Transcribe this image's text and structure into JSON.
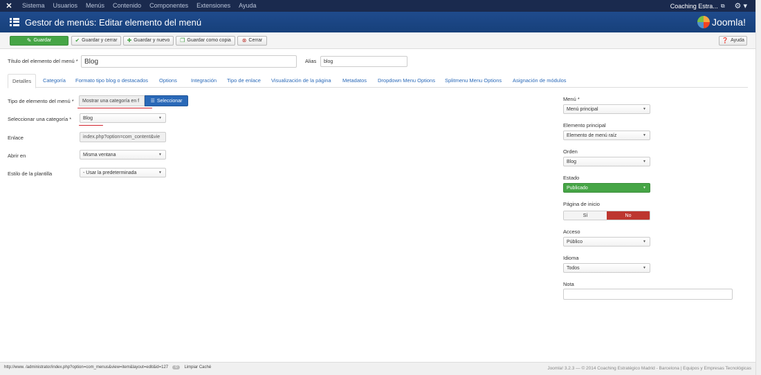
{
  "topnav": {
    "logo_glyph": "✕",
    "menu": [
      "Sistema",
      "Usuarios",
      "Menús",
      "Contenido",
      "Componentes",
      "Extensiones",
      "Ayuda"
    ],
    "site_name": "Coaching Estra...",
    "external_glyph": "⧉",
    "settings_glyph": "⚙ ▾"
  },
  "header": {
    "title": "Gestor de menús: Editar elemento del menú",
    "brand": "Joomla!"
  },
  "toolbar": {
    "save": "Guardar",
    "save_close": "Guardar y cerrar",
    "save_new": "Guardar y nuevo",
    "save_copy": "Guardar como copia",
    "close": "Cerrar",
    "help": "Ayuda",
    "icons": {
      "save": "edit-icon",
      "save_close": "check-icon",
      "save_new": "plus-icon",
      "save_copy": "copy-icon",
      "close": "close-icon",
      "help": "question-icon"
    }
  },
  "form": {
    "title_label": "Título del elemento del menú *",
    "title_value": "Blog",
    "alias_label": "Alias",
    "alias_value": "blog"
  },
  "tabs": [
    "Detalles",
    "Categoría",
    "Formato tipo blog o destacados",
    "Options",
    "Integración",
    "Tipo de enlace",
    "Visualización de la página",
    "Metadatos",
    "Dropdown Menu Options",
    "Splitmenu Menu Options",
    "Asignación de módulos"
  ],
  "details": {
    "type_label": "Tipo de elemento del menú *",
    "type_value": "Mostrar una categoría en f",
    "select_button": "Seleccionar",
    "category_label": "Seleccionar una categoría *",
    "category_value": "Blog",
    "link_label": "Enlace",
    "link_value": "index.php?option=com_content&vie",
    "open_label": "Abrir en",
    "open_value": "Misma ventana",
    "template_label": "Estilo de la plantilla",
    "template_value": "- Usar la predeterminada"
  },
  "sidebar": {
    "menu_label": "Menú *",
    "menu_value": "Menú principal",
    "parent_label": "Elemento principal",
    "parent_value": "Elemento de menú raíz",
    "order_label": "Orden",
    "order_value": "Blog",
    "state_label": "Estado",
    "state_value": "Publicado",
    "home_label": "Página de inicio",
    "home_yes": "Sí",
    "home_no": "No",
    "access_label": "Acceso",
    "access_value": "Público",
    "language_label": "Idioma",
    "language_value": "Todos",
    "note_label": "Nota",
    "note_value": ""
  },
  "footer": {
    "status_url": "http://www.               /administrator/index.php?option=com_menus&view=item&layout=edit&id=127",
    "count_pill": "0",
    "clear_cache": "Limpiar Caché",
    "copyright": "Joomla! 3.2.3  —  © 2014 Coaching Estratégico Madrid - Barcelona | Equipos y Empresas Tecnológicas"
  },
  "colors": {
    "topnav": "#1a2a4e",
    "header": "#1f4b8d",
    "save_green": "#46a546",
    "select_blue": "#2a69b8",
    "no_red": "#bd362f",
    "annotation_red": "#d0202a"
  }
}
